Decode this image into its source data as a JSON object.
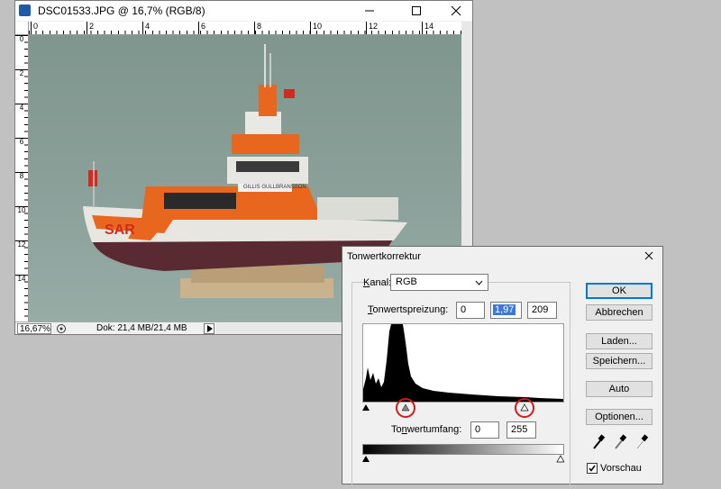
{
  "document_window": {
    "title": "DSC01533.JPG @ 16,7% (RGB/8)",
    "ruler_h_labels": [
      "0",
      "2",
      "4",
      "6",
      "8",
      "10",
      "12",
      "14"
    ],
    "ruler_v_labels": [
      "0",
      "2",
      "4",
      "6",
      "8",
      "10",
      "12",
      "14"
    ],
    "canvas_text": "SAR",
    "boat_name": "GILLIS GULLBRANSSON",
    "status": {
      "zoom": "16,67%",
      "doc_info": "Dok: 21,4 MB/21,4 MB"
    }
  },
  "levels_dialog": {
    "title": "Tonwertkorrektur",
    "channel_label_underlined": "K",
    "channel_label_rest": "anal:",
    "channel_value": "RGB",
    "input_levels_label_underlined": "T",
    "input_levels_label_rest": "onwertspreizung:",
    "input_black": "0",
    "input_gamma": "1,97",
    "input_white": "209",
    "output_levels_label_a": "To",
    "output_levels_label_underlined": "n",
    "output_levels_label_b": "wertumfang:",
    "output_black": "0",
    "output_white": "255",
    "buttons": {
      "ok": "OK",
      "cancel": "Abbrechen",
      "load": "Laden...",
      "save": "Speichern...",
      "auto": "Auto",
      "options": "Optionen..."
    },
    "preview_label": "Vorschau",
    "preview_checked": true
  },
  "colors": {
    "accent_blue": "#0078d7",
    "selection_blue": "#3b78d8",
    "highlight_circle": "#d21a1a",
    "hull_orange": "#e8661e"
  }
}
